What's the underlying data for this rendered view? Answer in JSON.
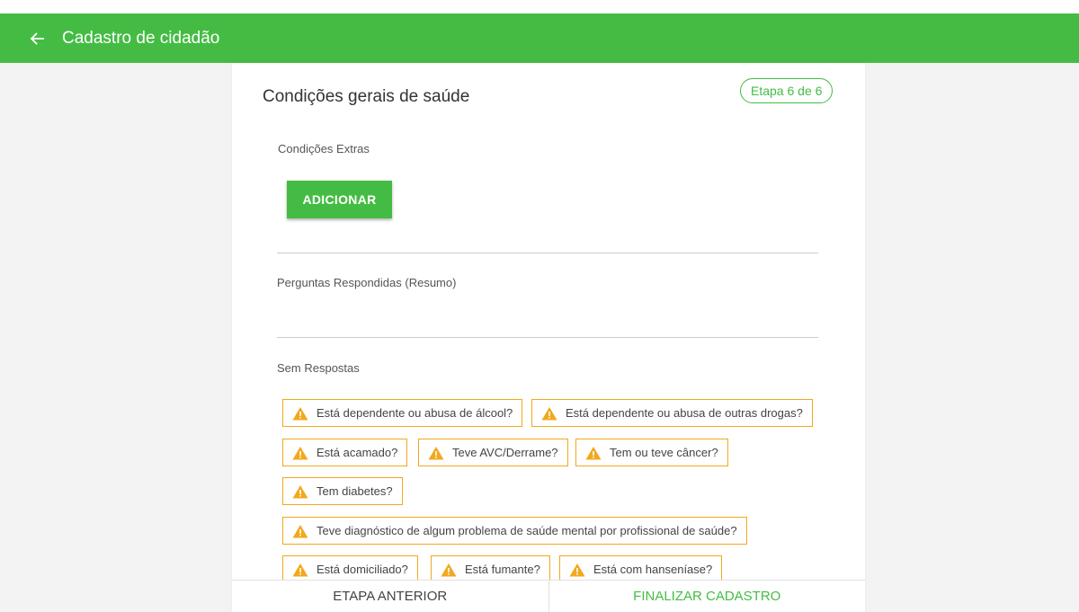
{
  "app": {
    "title": "Cadastro de cidadão"
  },
  "section": {
    "title": "Condições gerais de saúde",
    "step": "Etapa 6 de 6"
  },
  "extras": {
    "label": "Condições Extras",
    "add_label": "ADICIONAR"
  },
  "answered": {
    "label": "Perguntas Respondidas (Resumo)"
  },
  "unanswered": {
    "label": "Sem Respostas",
    "chips": [
      "Está dependente ou abusa de álcool?",
      "Está dependente ou abusa de outras drogas?",
      "Está acamado?",
      "Teve AVC/Derrame?",
      "Tem ou teve câncer?",
      "Tem diabetes?",
      "Teve diagnóstico de algum problema de saúde mental por profissional de saúde?",
      "Está domiciliado?",
      "Está fumante?",
      "Está com hanseníase?"
    ]
  },
  "footer": {
    "prev_label": "ETAPA ANTERIOR",
    "next_label": "FINALIZAR CADASTRO"
  },
  "colors": {
    "primary": "#44bc44",
    "warning": "#f2a81d"
  },
  "icons": {
    "back": "arrow-left-icon",
    "warning": "warning-triangle-icon"
  }
}
